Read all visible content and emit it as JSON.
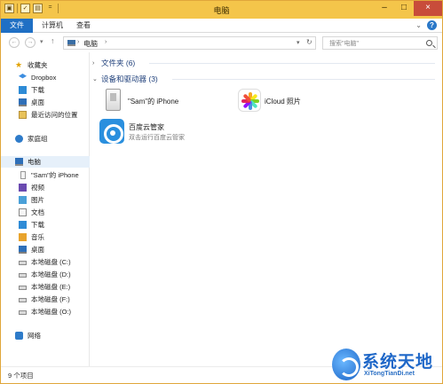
{
  "window": {
    "title": "电脑",
    "controls": {
      "minimize": "–",
      "maximize": "□",
      "close": "×"
    }
  },
  "quick_access": {
    "dropdown": "="
  },
  "menu": {
    "file": "文件",
    "computer": "计算机",
    "view": "查看"
  },
  "navigation": {
    "back": "←",
    "forward": "→",
    "recent": "▾",
    "up": "↑",
    "path_root": "电脑",
    "path_arrow": "›",
    "dropdown": "▾",
    "refresh": "↻",
    "search_placeholder": "搜索\"电脑\""
  },
  "sidebar": {
    "favorites": {
      "title": "收藏夹",
      "items": [
        "Dropbox",
        "下载",
        "桌面",
        "最近访问的位置"
      ]
    },
    "homegroup": "家庭组",
    "computer": {
      "title": "电脑",
      "items": [
        "\"Sam\"的 iPhone",
        "视频",
        "图片",
        "文档",
        "下载",
        "音乐",
        "桌面",
        "本地磁盘 (C:)",
        "本地磁盘 (D:)",
        "本地磁盘 (E:)",
        "本地磁盘 (F:)",
        "本地磁盘 (O:)"
      ]
    },
    "network": "网络"
  },
  "content": {
    "folders_group": "文件夹 (6)",
    "devices_group": "设备和驱动器 (3)",
    "devices": [
      {
        "name": "\"Sam\"的 iPhone",
        "icon": "iphone-icon"
      },
      {
        "name": "iCloud 照片",
        "icon": "photos-icon"
      },
      {
        "name": "百度云管家",
        "subtitle": "双击运行百度云管家",
        "icon": "baidu-cloud-icon"
      }
    ]
  },
  "status": {
    "item_count": "9 个项目"
  },
  "watermark": {
    "title": "系统天地",
    "url": "XiTongTianDi.net"
  },
  "colors": {
    "titlebar": "#f4c54a",
    "accent": "#1f6fc4",
    "close": "#c84c3a"
  }
}
